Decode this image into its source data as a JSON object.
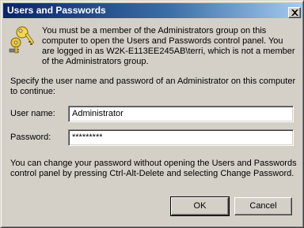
{
  "window": {
    "title": "Users and Passwords"
  },
  "message": {
    "lines": [
      "You must be a member of the Administrators group on this",
      "computer to open the Users and Passwords control panel.  You",
      "are logged in as W2K-E113EE245AB\\terri, which is not a member",
      "of the Administrators group."
    ]
  },
  "instruction": {
    "lines": [
      "Specify the user name and password of an Administrator on this computer",
      "to continue:"
    ]
  },
  "form": {
    "username_label": "User name:",
    "username_value": "Administrator",
    "password_label": "Password:",
    "password_value": "*********"
  },
  "hint": {
    "lines": [
      "You can change your password without opening the Users and Passwords",
      "control panel by pressing Ctrl-Alt-Delete and selecting Change Password."
    ]
  },
  "buttons": {
    "ok": "OK",
    "cancel": "Cancel"
  },
  "icons": {
    "title_close": "close-icon",
    "dialog_icon": "keys-icon"
  }
}
